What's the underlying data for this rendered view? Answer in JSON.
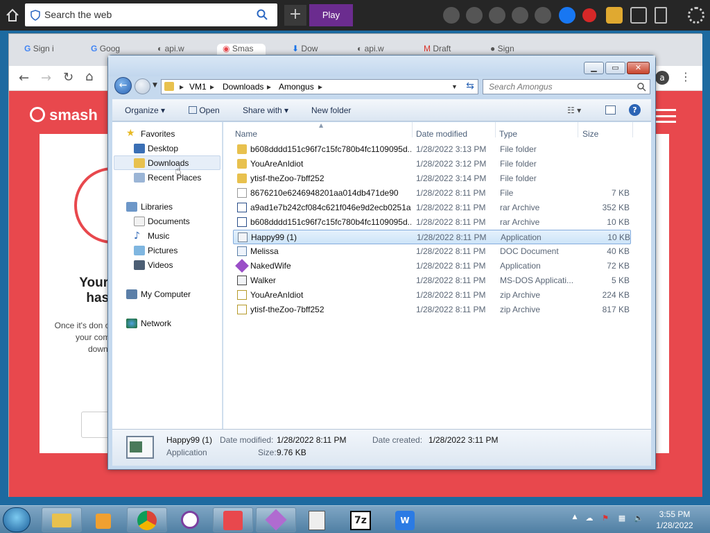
{
  "top_toolbar": {
    "search_placeholder": "Search the web",
    "play_label": "Play",
    "new_tab_label": "+"
  },
  "chrome": {
    "tabs": [
      {
        "label": "Sign i"
      },
      {
        "label": "Goog"
      },
      {
        "label": "api.w"
      },
      {
        "label": "Smas"
      },
      {
        "label": "Dow"
      },
      {
        "label": "api.w"
      },
      {
        "label": "Draft"
      },
      {
        "label": "Sign"
      }
    ],
    "profile_initial": "a",
    "page": {
      "logo": "smash",
      "heading": "Your d has s",
      "description": "Once it's don on your comp downlo"
    }
  },
  "explorer": {
    "breadcrumb": [
      "VM1",
      "Downloads",
      "Amongus"
    ],
    "search_placeholder": "Search Amongus",
    "commands": {
      "organize": "Organize",
      "open": "Open",
      "share_with": "Share with",
      "new_folder": "New folder"
    },
    "nav": {
      "favorites": "Favorites",
      "favorites_items": [
        "Desktop",
        "Downloads",
        "Recent Places"
      ],
      "libraries": "Libraries",
      "libraries_items": [
        "Documents",
        "Music",
        "Pictures",
        "Videos"
      ],
      "my_computer": "My Computer",
      "network": "Network"
    },
    "columns": {
      "name": "Name",
      "date": "Date modified",
      "type": "Type",
      "size": "Size"
    },
    "files": [
      {
        "name": "b608dddd151c96f7c15fc780b4fc1109095d...",
        "date": "1/28/2022 3:13 PM",
        "type": "File folder",
        "size": "",
        "icon": "folder-icon"
      },
      {
        "name": "YouAreAnIdiot",
        "date": "1/28/2022 3:12 PM",
        "type": "File folder",
        "size": "",
        "icon": "folder-icon"
      },
      {
        "name": "ytisf-theZoo-7bff252",
        "date": "1/28/2022 3:14 PM",
        "type": "File folder",
        "size": "",
        "icon": "folder-icon"
      },
      {
        "name": "8676210e6246948201aa014db471de90",
        "date": "1/28/2022 8:11 PM",
        "type": "File",
        "size": "7 KB",
        "icon": "blank-file-icon"
      },
      {
        "name": "a9ad1e7b242cf084c621f046e9d2ecb0251a...",
        "date": "1/28/2022 8:11 PM",
        "type": "rar Archive",
        "size": "352 KB",
        "icon": "rar-archive-icon"
      },
      {
        "name": "b608dddd151c96f7c15fc780b4fc1109095d...",
        "date": "1/28/2022 8:11 PM",
        "type": "rar Archive",
        "size": "10 KB",
        "icon": "rar-archive-icon"
      },
      {
        "name": "Happy99 (1)",
        "date": "1/28/2022 8:11 PM",
        "type": "Application",
        "size": "10 KB",
        "icon": "application-icon",
        "selected": true
      },
      {
        "name": "Melissa",
        "date": "1/28/2022 8:11 PM",
        "type": "DOC Document",
        "size": "40 KB",
        "icon": "doc-file-icon"
      },
      {
        "name": "NakedWife",
        "date": "1/28/2022 8:11 PM",
        "type": "Application",
        "size": "72 KB",
        "icon": "purple-app-icon"
      },
      {
        "name": "Walker",
        "date": "1/28/2022 8:11 PM",
        "type": "MS-DOS Applicati...",
        "size": "5 KB",
        "icon": "msdos-app-icon"
      },
      {
        "name": "YouAreAnIdiot",
        "date": "1/28/2022 8:11 PM",
        "type": "zip Archive",
        "size": "224 KB",
        "icon": "zip-archive-icon"
      },
      {
        "name": "ytisf-theZoo-7bff252",
        "date": "1/28/2022 8:11 PM",
        "type": "zip Archive",
        "size": "817 KB",
        "icon": "zip-archive-icon"
      }
    ],
    "details": {
      "name": "Happy99 (1)",
      "type": "Application",
      "date_modified_label": "Date modified:",
      "date_modified": "1/28/2022 8:11 PM",
      "date_created_label": "Date created:",
      "date_created": "1/28/2022 3:11 PM",
      "size_label": "Size:",
      "size": "9.76 KB"
    }
  },
  "taskbar": {
    "time": "3:55 PM",
    "date": "1/28/2022"
  },
  "colors": {
    "smash_red": "#e8484d",
    "selection_blue": "#cde4f8",
    "play_purple": "#6b2c8f"
  }
}
